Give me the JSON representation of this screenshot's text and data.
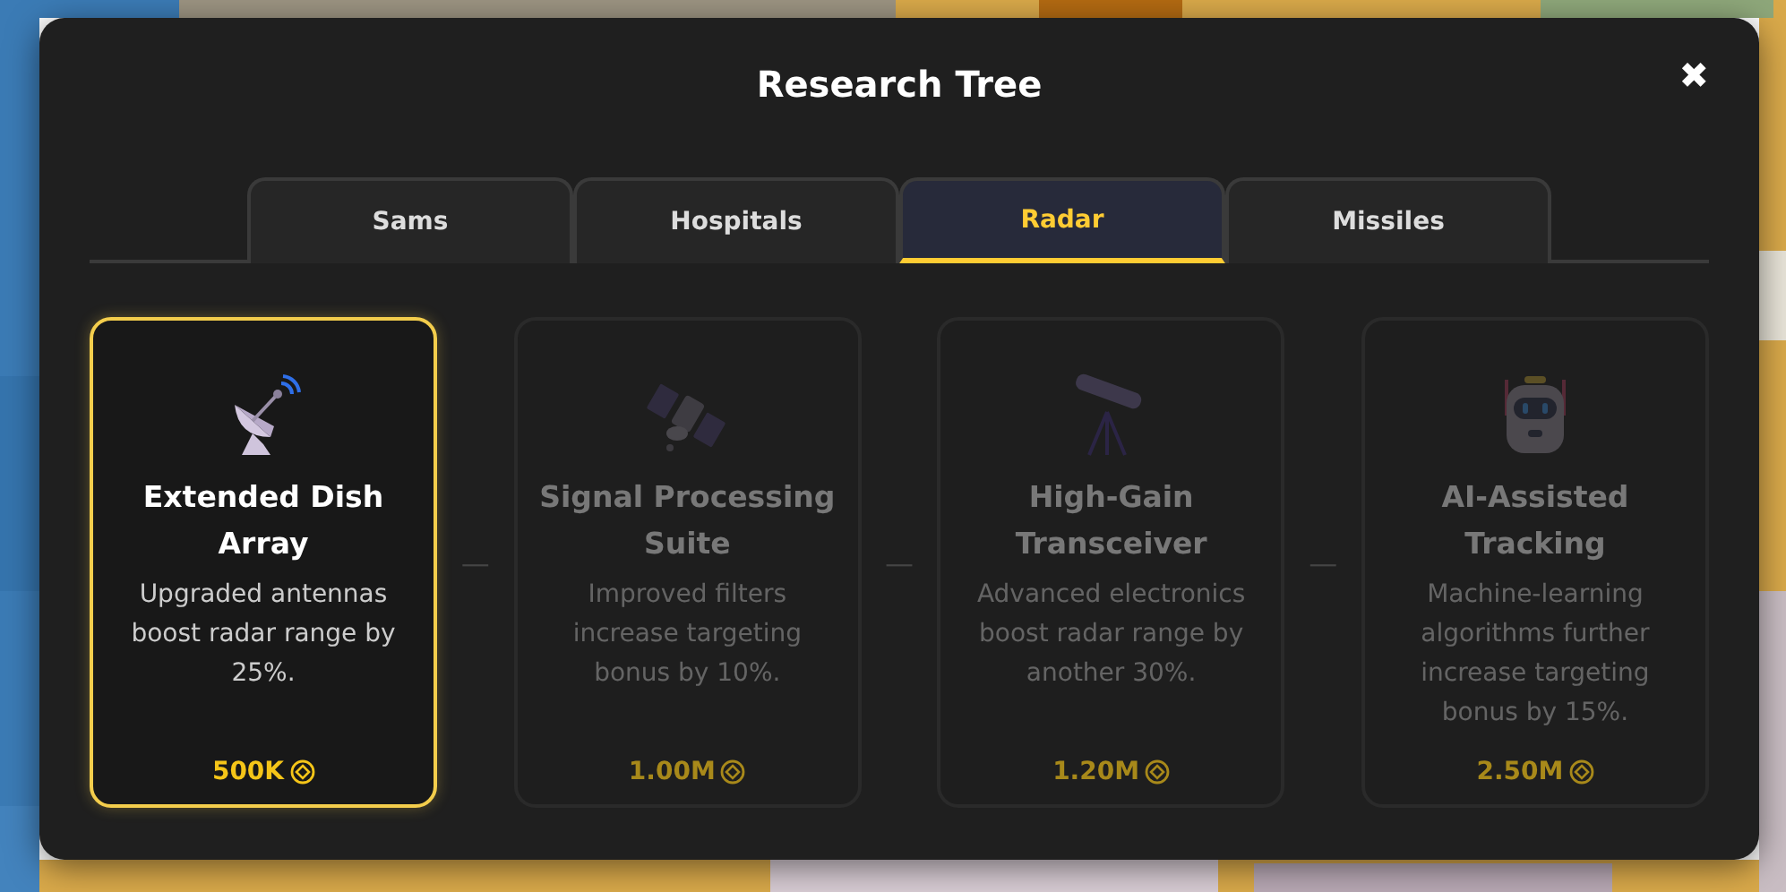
{
  "dialog": {
    "title": "Research Tree",
    "close": "✖"
  },
  "tabs": [
    {
      "label": "Sams",
      "selected": false
    },
    {
      "label": "Hospitals",
      "selected": false
    },
    {
      "label": "Radar",
      "selected": true
    },
    {
      "label": "Missiles",
      "selected": false
    }
  ],
  "connector": "—",
  "upgrades": [
    {
      "name": "Extended Dish Array",
      "description": "Upgraded antennas boost radar range by 25%.",
      "cost": "500K",
      "locked": false
    },
    {
      "name": "Signal Processing Suite",
      "description": "Improved filters increase targeting bonus by 10%.",
      "cost": "1.00M",
      "locked": true
    },
    {
      "name": "High-Gain Transceiver",
      "description": "Advanced electronics boost radar range by another 30%.",
      "cost": "1.20M",
      "locked": true
    },
    {
      "name": "AI-Assisted Tracking",
      "description": "Machine-learning algorithms further increase targeting bonus by 15%.",
      "cost": "2.50M",
      "locked": true
    }
  ]
}
